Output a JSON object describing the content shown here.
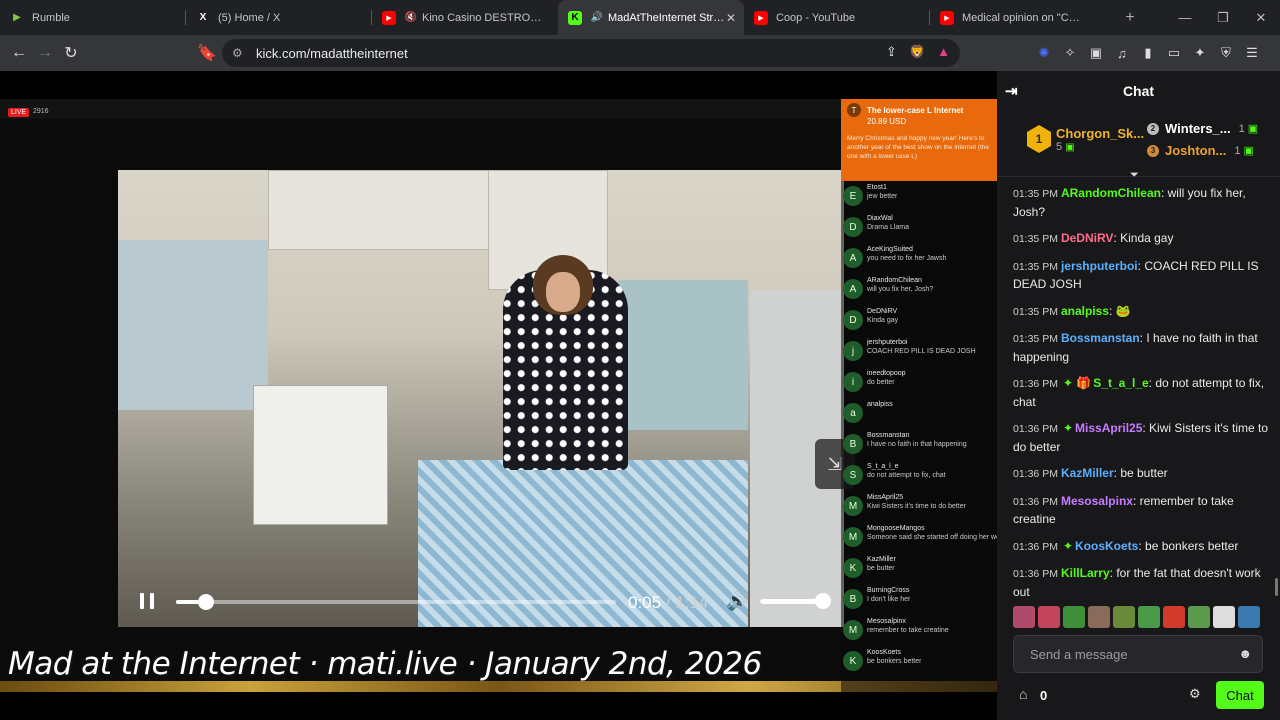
{
  "tabs": [
    {
      "label": "Rumble",
      "color": "#85c742",
      "icon": "rumble-icon"
    },
    {
      "label": "(5) Home / X",
      "color": "#ffffff",
      "icon": "x-icon"
    },
    {
      "label": "Kino Casino DESTROYS DSP",
      "color": "#ff0000",
      "icon": "youtube-icon"
    },
    {
      "label": "MadAtTheInternet Stream",
      "color": "#53fc18",
      "icon": "kick-icon"
    },
    {
      "label": "Coop - YouTube",
      "color": "#ff0000",
      "icon": "youtube-icon"
    },
    {
      "label": "Medical opinion on \"Cyraxx\"'s m",
      "color": "#ff0000",
      "icon": "youtube-icon"
    }
  ],
  "address": {
    "url": "kick.com/madattheinternet"
  },
  "video": {
    "live_label": "LIVE",
    "viewer_count": "2916",
    "current_time": "0:05",
    "duration": "1:14",
    "progress": 0.068,
    "volume": 0.98,
    "caption": "Mad at the Internet · mati.live · January 2nd, 2026"
  },
  "overlay": {
    "donation": {
      "name": "The lower-case L Internet",
      "amount": "20.89 USD",
      "message": "Merry Christmas and happy new year! Here's to another year of the best show on the internet (the one with a lower case L)"
    },
    "items": [
      {
        "initial": "E",
        "user": "Etost1",
        "msg": "jew better"
      },
      {
        "initial": "D",
        "user": "DiaxWal",
        "msg": "Drama Llama"
      },
      {
        "initial": "A",
        "user": "AceKingSuited",
        "msg": "you need to fix her Jawsh"
      },
      {
        "initial": "A",
        "user": "ARandomChilean",
        "msg": "will you fix her, Josh?"
      },
      {
        "initial": "D",
        "user": "DeDNiRV",
        "msg": "Kinda gay"
      },
      {
        "initial": "j",
        "user": "jershputerboi",
        "msg": "COACH RED PILL IS DEAD JOSH"
      },
      {
        "initial": "i",
        "user": "ineedtopoop",
        "msg": "do better"
      },
      {
        "initial": "a",
        "user": "analpiss",
        "msg": ""
      },
      {
        "initial": "B",
        "user": "Bossmanstan",
        "msg": "I have no faith in that happening"
      },
      {
        "initial": "S",
        "user": "S_t_a_l_e",
        "msg": "do not attempt to fix, chat"
      },
      {
        "initial": "M",
        "user": "MissApril25",
        "msg": "Kiwi Sisters it's time to do better"
      },
      {
        "initial": "M",
        "user": "MongooseMangos",
        "msg": "Someone said she started off doing her weird dances in her videos."
      },
      {
        "initial": "K",
        "user": "KazMiller",
        "msg": "be butter"
      },
      {
        "initial": "B",
        "user": "BurningCross",
        "msg": "I don't like her"
      },
      {
        "initial": "M",
        "user": "Mesosalpinx",
        "msg": "remember to take creatine"
      },
      {
        "initial": "K",
        "user": "KoosKoets",
        "msg": "be bonkers better"
      }
    ]
  },
  "chat": {
    "title": "Chat",
    "leaders": {
      "first": {
        "rank": "1",
        "name": "Chorgon_Sk...",
        "count": "5"
      },
      "second": {
        "rank": "2",
        "name": "Winters_...",
        "count": "1"
      },
      "third": {
        "rank": "3",
        "name": "Joshton...",
        "count": "1"
      }
    },
    "messages": [
      {
        "time": "01:35 PM",
        "user": "ARandomChilean",
        "color": "#53fc18",
        "badge": "",
        "text": "will you fix her, Josh?"
      },
      {
        "time": "01:35 PM",
        "user": "DeDNiRV",
        "color": "#ff6b8b",
        "badge": "",
        "text": "Kinda gay"
      },
      {
        "time": "01:35 PM",
        "user": "jershputerboi",
        "color": "#5ab0ff",
        "badge": "",
        "text": "COACH RED PILL IS DEAD JOSH"
      },
      {
        "time": "01:35 PM",
        "user": "analpiss",
        "color": "#53fc18",
        "badge": "",
        "text": "🐸"
      },
      {
        "time": "01:35 PM",
        "user": "Bossmanstan",
        "color": "#5ab0ff",
        "badge": "",
        "text": "I have no faith in that happening"
      },
      {
        "time": "01:36 PM",
        "user": "S_t_a_l_e",
        "color": "#53fc18",
        "badge": "✦ 🎁",
        "text": "do not attempt to fix, chat"
      },
      {
        "time": "01:36 PM",
        "user": "MissApril25",
        "color": "#c77dff",
        "badge": "✦",
        "text": "Kiwi Sisters it's time to do better"
      },
      {
        "time": "01:36 PM",
        "user": "KazMiller",
        "color": "#5ab0ff",
        "badge": "",
        "text": "be butter"
      },
      {
        "time": "01:36 PM",
        "user": "Mesosalpinx",
        "color": "#c77dff",
        "badge": "",
        "text": "remember to take creatine"
      },
      {
        "time": "01:36 PM",
        "user": "KoosKoets",
        "color": "#5ab0ff",
        "badge": "✦",
        "text": "be bonkers better"
      },
      {
        "time": "01:36 PM",
        "user": "KillLarry",
        "color": "#53fc18",
        "badge": "",
        "text": "for the fat that doesn't work out"
      }
    ],
    "emotes": [
      "#b04a6a",
      "#c2455c",
      "#3f8f3a",
      "#8a6a5a",
      "#6a8a3a",
      "#4a9a4a",
      "#d23a2a",
      "#5a9a4a",
      "#ddd",
      "#3a7ab0"
    ],
    "input_placeholder": "Send a message",
    "points": "0",
    "send_label": "Chat"
  }
}
